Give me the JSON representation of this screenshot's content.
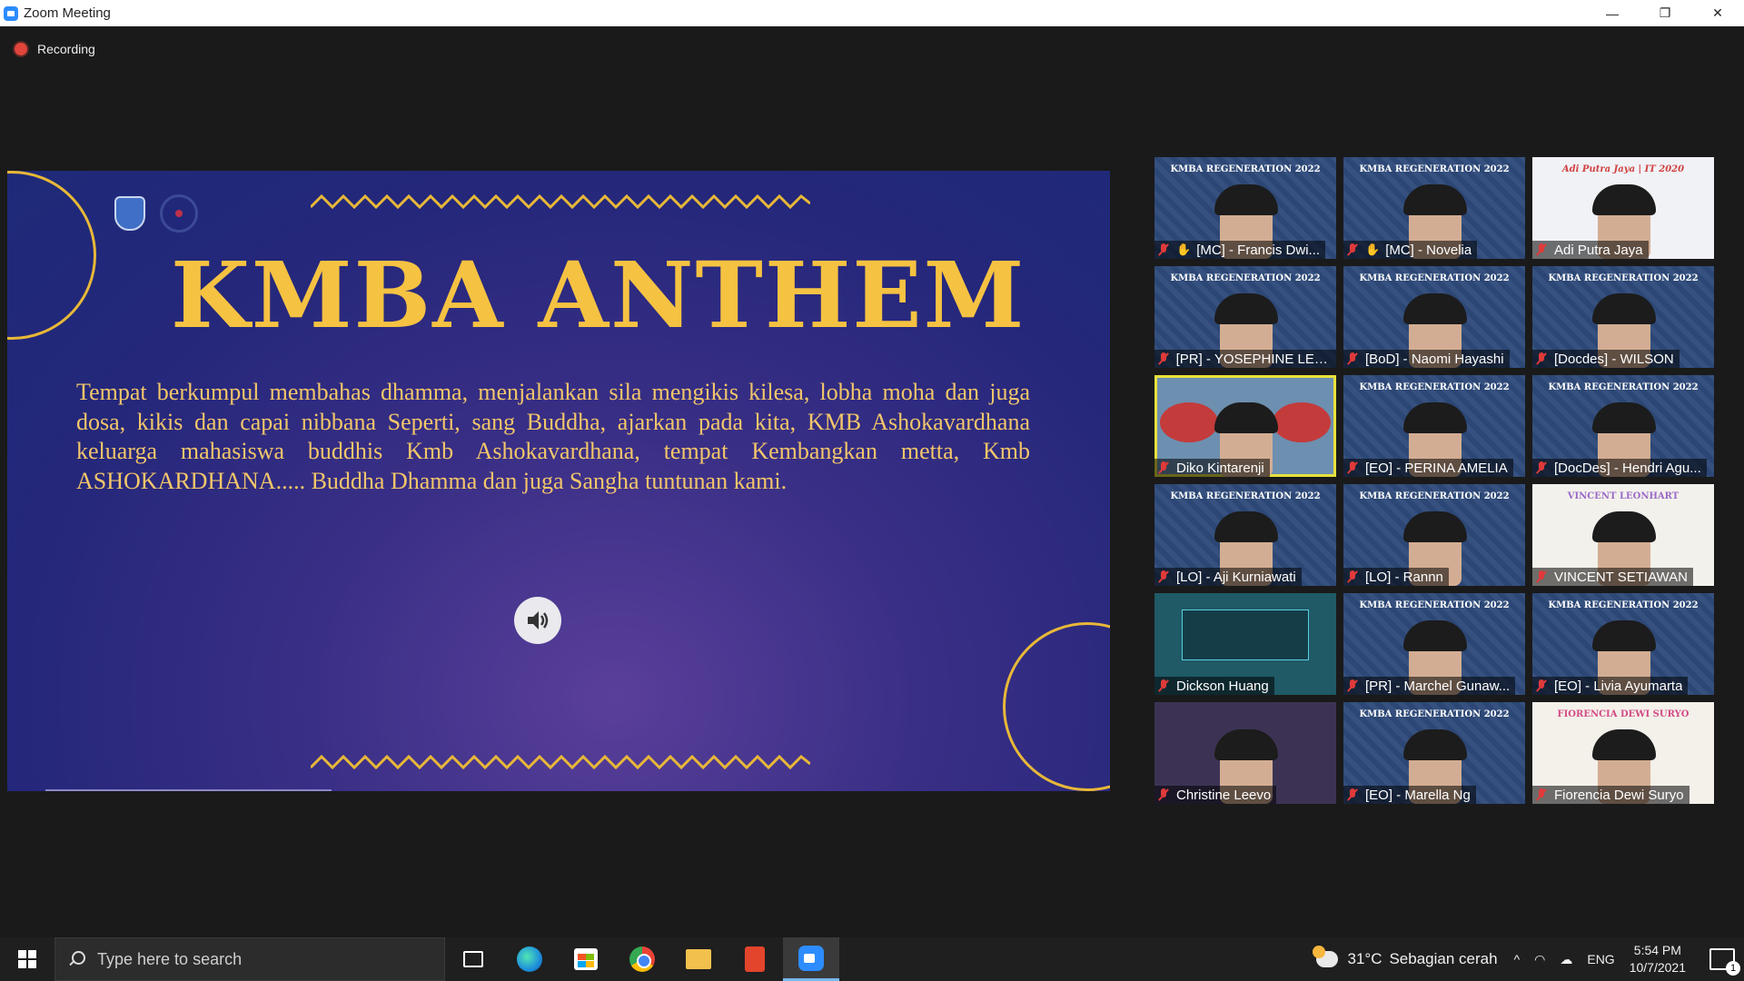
{
  "window": {
    "title": "Zoom Meeting",
    "minimize_glyph": "—",
    "maximize_glyph": "❐",
    "close_glyph": "✕"
  },
  "recording": {
    "label": "Recording",
    "color": "#e0453b"
  },
  "shared_screen": {
    "heading": "KMBA ANTHEM",
    "lyrics": "Tempat berkumpul membahas dhamma, menjalankan sila mengikis kilesa, lobha moha dan juga dosa, kikis dan capai nibbana Seperti, sang Buddha, ajarkan pada kita, KMB Ashokavardhana keluarga mahasiswa buddhis Kmb Ashokavardhana, tempat Kembangkan metta, Kmb ASHOKARDHANA.....  Buddha Dhamma dan juga Sangha tuntunan kami.",
    "audio_icon": "speaker-icon",
    "heading_color": "#f5c242",
    "lyrics_color": "#f3c66a"
  },
  "participants": [
    {
      "name": "[MC] - Francis Dwi...",
      "banner": "KMBA REGENERATION 2022",
      "hand": "✋",
      "active": false,
      "variant": "regen"
    },
    {
      "name": "[MC] - Novelia",
      "banner": "KMBA REGENERATION 2022",
      "hand": "✋",
      "active": false,
      "variant": "regen"
    },
    {
      "name": "Adi Putra Jaya",
      "banner": "Adi Putra Jaya | IT 2020",
      "hand": "",
      "active": false,
      "variant": "alt1"
    },
    {
      "name": "[PR] - YOSEPHINE LEO...",
      "banner": "KMBA REGENERATION 2022",
      "hand": "",
      "active": false,
      "variant": "regen"
    },
    {
      "name": "[BoD] - Naomi Hayashi",
      "banner": "KMBA REGENERATION 2022",
      "hand": "",
      "active": false,
      "variant": "regen"
    },
    {
      "name": "[Docdes] - WILSON",
      "banner": "KMBA REGENERATION 2022",
      "hand": "",
      "active": false,
      "variant": "regen"
    },
    {
      "name": "Diko Kintarenji",
      "banner": "",
      "hand": "",
      "active": true,
      "variant": "alt2"
    },
    {
      "name": "[EO] - PERINA AMELIA",
      "banner": "KMBA REGENERATION 2022",
      "hand": "",
      "active": false,
      "variant": "regen"
    },
    {
      "name": "[DocDes] - Hendri Agu...",
      "banner": "KMBA REGENERATION 2022",
      "hand": "",
      "active": false,
      "variant": "regen"
    },
    {
      "name": "[LO] - Aji Kurniawati",
      "banner": "KMBA REGENERATION 2022",
      "hand": "",
      "active": false,
      "variant": "regen"
    },
    {
      "name": "[LO] - Rannn",
      "banner": "KMBA REGENERATION 2022",
      "hand": "",
      "active": false,
      "variant": "regen"
    },
    {
      "name": "VINCENT SETIAWAN",
      "banner": "VINCENT LEONHART",
      "hand": "",
      "active": false,
      "variant": "alt3"
    },
    {
      "name": "Dickson Huang",
      "banner": "",
      "hand": "",
      "active": false,
      "variant": "alt4"
    },
    {
      "name": "[PR] - Marchel Gunaw...",
      "banner": "KMBA REGENERATION 2022",
      "hand": "",
      "active": false,
      "variant": "regen"
    },
    {
      "name": "[EO] - Livia Ayumarta",
      "banner": "KMBA REGENERATION 2022",
      "hand": "",
      "active": false,
      "variant": "regen"
    },
    {
      "name": "Christine Leevo",
      "banner": "",
      "hand": "",
      "active": false,
      "variant": "alt5"
    },
    {
      "name": "[EO] - Marella Ng",
      "banner": "KMBA REGENERATION 2022",
      "hand": "",
      "active": false,
      "variant": "regen"
    },
    {
      "name": "Fiorencia Dewi Suryo",
      "banner": "FIORENCIA DEWI SURYO",
      "hand": "",
      "active": false,
      "variant": "alt6"
    }
  ],
  "taskbar": {
    "search_placeholder": "Type here to search",
    "apps": [
      "task-view-icon",
      "edge-icon",
      "store-icon",
      "chrome-icon",
      "file-explorer-icon",
      "office-icon",
      "zoom-icon"
    ],
    "active_app": "zoom-icon",
    "weather_temp": "31°C",
    "weather_condition": "Sebagian cerah",
    "tray_chevron": "^",
    "language": "ENG",
    "time": "5:54 PM",
    "date": "10/7/2021",
    "notification_count": "1"
  }
}
